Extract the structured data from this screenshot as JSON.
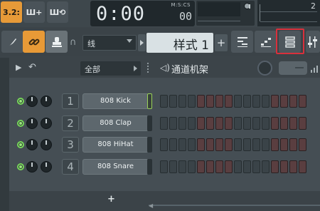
{
  "transport": {
    "tempo_button": "3.2:",
    "song_button": "Ш+",
    "loop_button": "Ш⟲",
    "time_main": "0:00",
    "time_sub": "00",
    "time_format": "M:S:CS",
    "right_value": "2"
  },
  "toolbar": {
    "snap_value": "线",
    "pattern_name": "样式 1",
    "pattern_add": "+"
  },
  "rack": {
    "filter_value": "全部",
    "title": "通道机架",
    "add_button": "+",
    "channels": [
      {
        "num": "1",
        "name": "808 Kick"
      },
      {
        "num": "2",
        "name": "808 Clap"
      },
      {
        "num": "3",
        "name": "808 HiHat"
      },
      {
        "num": "4",
        "name": "808 Snare"
      }
    ]
  },
  "colors": {
    "accent_orange": "#e89a37",
    "selection_red": "#d9303c",
    "led_green": "#77d65a"
  }
}
